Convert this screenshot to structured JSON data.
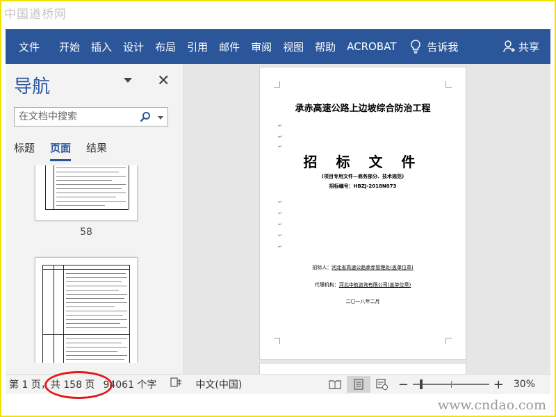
{
  "watermark_top": "中国道桥网",
  "watermark_bottom": "www.cndao.com",
  "ribbon": {
    "tabs": [
      "文件",
      "开始",
      "插入",
      "设计",
      "布局",
      "引用",
      "邮件",
      "审阅",
      "视图",
      "帮助",
      "ACROBAT"
    ],
    "tell_me": "告诉我",
    "share": "共享"
  },
  "nav": {
    "title": "导航",
    "search_placeholder": "在文档中搜索",
    "tabs": [
      "标题",
      "页面",
      "结果"
    ],
    "active_tab": "页面",
    "thumb_label": "58"
  },
  "document": {
    "title": "承赤高速公路上边坡综合防治工程",
    "heading": "招 标 文 件",
    "subtitle": "(项目专用文件—商务部分、技术规范)",
    "number": "招标编号：HBZJ-2018N073",
    "tenderer_label": "招标人：",
    "tenderer": "河北省高速公路承赤管理处(盖单位章)",
    "agent_label": "代理机构：",
    "agent": "河北中航咨询有限公司(盖单位章)",
    "date": "二〇一八年二月"
  },
  "status": {
    "page_info": "第 1 页，共 158 页",
    "words": "94061 个字",
    "language": "中文(中国)",
    "zoom": "30%",
    "zoom_fraction": 0.3
  },
  "colors": {
    "ribbon": "#2b579a",
    "highlight_oval": "#e01919",
    "frame": "#f2e200"
  }
}
